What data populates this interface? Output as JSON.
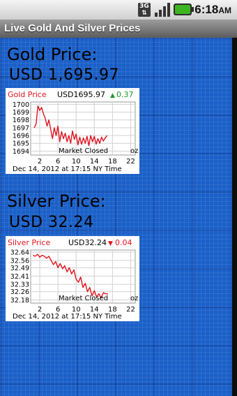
{
  "status_bar": {
    "network_label": "3G",
    "time": "6:18",
    "ampm": "AM",
    "battery_color": "#3cb521"
  },
  "app": {
    "title": "Live Gold And Silver Prices"
  },
  "gold": {
    "label": "Gold Price:",
    "price": "USD 1,695.97",
    "chart": {
      "header_name": "Gold Price",
      "header_price": "USD1695.97",
      "change_symbol": "▲",
      "change_value": "0.37",
      "change_color": "#1a9a2a",
      "market_status": "Market Closed",
      "unit": "oz",
      "timestamp": "Dec 14, 2012 at 17:15 NY Time",
      "line_color": "#e0141e"
    }
  },
  "silver": {
    "label": "Silver Price:",
    "price": "USD 32.24",
    "chart": {
      "header_name": "Silver Price",
      "header_price": "USD32.24",
      "change_symbol": "▼",
      "change_value": "0.04",
      "change_color": "#e0141e",
      "market_status": "Market Closed",
      "unit": "oz",
      "timestamp": "Dec 14, 2012 at 17:15 NY Time",
      "line_color": "#e0141e"
    }
  },
  "chart_data": [
    {
      "type": "line",
      "title": "Gold Price",
      "x_ticks": [
        "2",
        "6",
        "10",
        "14",
        "18",
        "22"
      ],
      "y_ticks": [
        1700,
        1699,
        1698,
        1697,
        1696,
        1695,
        1694
      ],
      "xlim": [
        0,
        23
      ],
      "ylim": [
        1693.5,
        1700.3
      ],
      "series": [
        {
          "x": [
            0.8,
            1.2,
            1.6,
            2.0,
            2.4,
            2.8,
            3.2,
            3.6,
            4.0,
            4.4,
            4.8,
            5.2,
            5.6,
            6.0,
            6.4,
            6.8,
            7.2,
            7.6,
            8.0,
            8.4,
            8.8,
            9.2,
            9.6,
            10.0,
            10.4,
            10.8,
            11.2,
            11.6,
            12.0,
            12.4,
            12.8,
            13.2,
            13.6,
            14.0,
            14.4,
            14.8,
            15.2,
            15.6,
            16.0,
            16.4,
            16.8
          ],
          "y": [
            1697.0,
            1697.5,
            1699.8,
            1699.2,
            1699.6,
            1698.8,
            1698.2,
            1697.2,
            1698.0,
            1696.8,
            1695.6,
            1697.0,
            1696.0,
            1697.2,
            1695.2,
            1696.5,
            1695.6,
            1696.3,
            1695.2,
            1696.0,
            1695.0,
            1696.6,
            1695.5,
            1696.2,
            1694.8,
            1695.8,
            1694.9,
            1695.7,
            1695.0,
            1695.9,
            1694.7,
            1696.0,
            1695.2,
            1695.9,
            1694.9,
            1695.6,
            1695.0,
            1695.8,
            1695.3,
            1695.7,
            1696.0
          ]
        }
      ]
    },
    {
      "type": "line",
      "title": "Silver Price",
      "x_ticks": [
        "2",
        "6",
        "10",
        "14",
        "18",
        "22"
      ],
      "y_ticks": [
        32.64,
        32.56,
        32.49,
        32.41,
        32.33,
        32.26,
        32.18
      ],
      "xlim": [
        0,
        23
      ],
      "ylim": [
        32.15,
        32.66
      ],
      "series": [
        {
          "x": [
            0.5,
            1.0,
            1.5,
            2.0,
            2.5,
            3.0,
            3.5,
            4.0,
            4.5,
            5.0,
            5.5,
            6.0,
            6.5,
            7.0,
            7.5,
            8.0,
            8.5,
            9.0,
            9.5,
            10.0,
            10.5,
            11.0,
            11.5,
            12.0,
            12.5,
            13.0,
            13.5,
            14.0,
            14.5,
            15.0,
            15.5,
            16.0,
            16.5,
            17.0
          ],
          "y": [
            32.61,
            32.6,
            32.62,
            32.59,
            32.61,
            32.6,
            32.58,
            32.6,
            32.56,
            32.52,
            32.55,
            32.49,
            32.53,
            32.48,
            32.51,
            32.45,
            32.49,
            32.43,
            32.47,
            32.38,
            32.35,
            32.4,
            32.3,
            32.34,
            32.26,
            32.3,
            32.22,
            32.27,
            32.21,
            32.24,
            32.2,
            32.25,
            32.24,
            32.24
          ]
        }
      ]
    }
  ]
}
